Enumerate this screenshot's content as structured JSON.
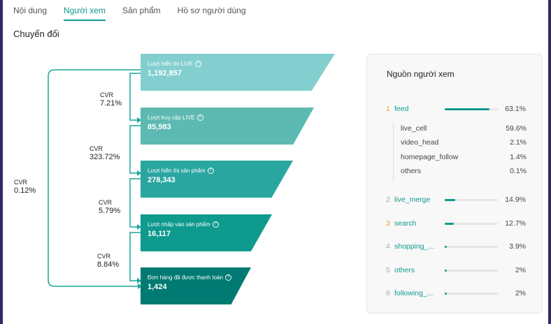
{
  "tabs": [
    "Nội dung",
    "Người xem",
    "Sản phẩm",
    "Hồ sơ người dùng"
  ],
  "section_title": "Chuyển đổi",
  "stages": [
    {
      "label": "Lượt hiển thị LIVE",
      "value": "1,192,857"
    },
    {
      "label": "Lượt truy cập LIVE",
      "value": "85,983"
    },
    {
      "label": "Lượt hiển thị sản phẩm",
      "value": "278,343"
    },
    {
      "label": "Lượt nhấp vào sản phẩm",
      "value": "16,117"
    },
    {
      "label": "Đơn hàng đã được thanh toán",
      "value": "1,424"
    }
  ],
  "stage_colors": [
    "#83cfcf",
    "#5cbab2",
    "#2aa6a0",
    "#0f9a8e",
    "#007a72"
  ],
  "cvr_label": "CVR",
  "cvrs": [
    "7.21%",
    "323.72%",
    "5.79%",
    "8.84%"
  ],
  "overall_cvr": "0.12%",
  "info_icon_glyph": "?",
  "sources": {
    "title": "Nguồn người xem",
    "top": [
      {
        "rank": "1",
        "name": "feed",
        "pct": "63.1%",
        "share": 0.631
      }
    ],
    "sub": [
      {
        "name": "live_cell",
        "pct": "59.6%"
      },
      {
        "name": "video_head",
        "pct": "2.1%"
      },
      {
        "name": "homepage_follow",
        "pct": "1.4%"
      },
      {
        "name": "others",
        "pct": "0.1%"
      }
    ],
    "rest": [
      {
        "rank": "2",
        "name": "live_merge",
        "pct": "14.9%",
        "share": 0.149
      },
      {
        "rank": "3",
        "name": "search",
        "pct": "12.7%",
        "share": 0.127
      },
      {
        "rank": "4",
        "name": "shopping_...",
        "pct": "3.9%",
        "share": 0.039
      },
      {
        "rank": "5",
        "name": "others",
        "pct": "2%",
        "share": 0.02
      },
      {
        "rank": "6",
        "name": "following_...",
        "pct": "2%",
        "share": 0.02
      }
    ]
  },
  "colors": {
    "accent": "#0f9a8e",
    "rank_top": "#f0a020",
    "rank_other": "#aaaaaa"
  }
}
